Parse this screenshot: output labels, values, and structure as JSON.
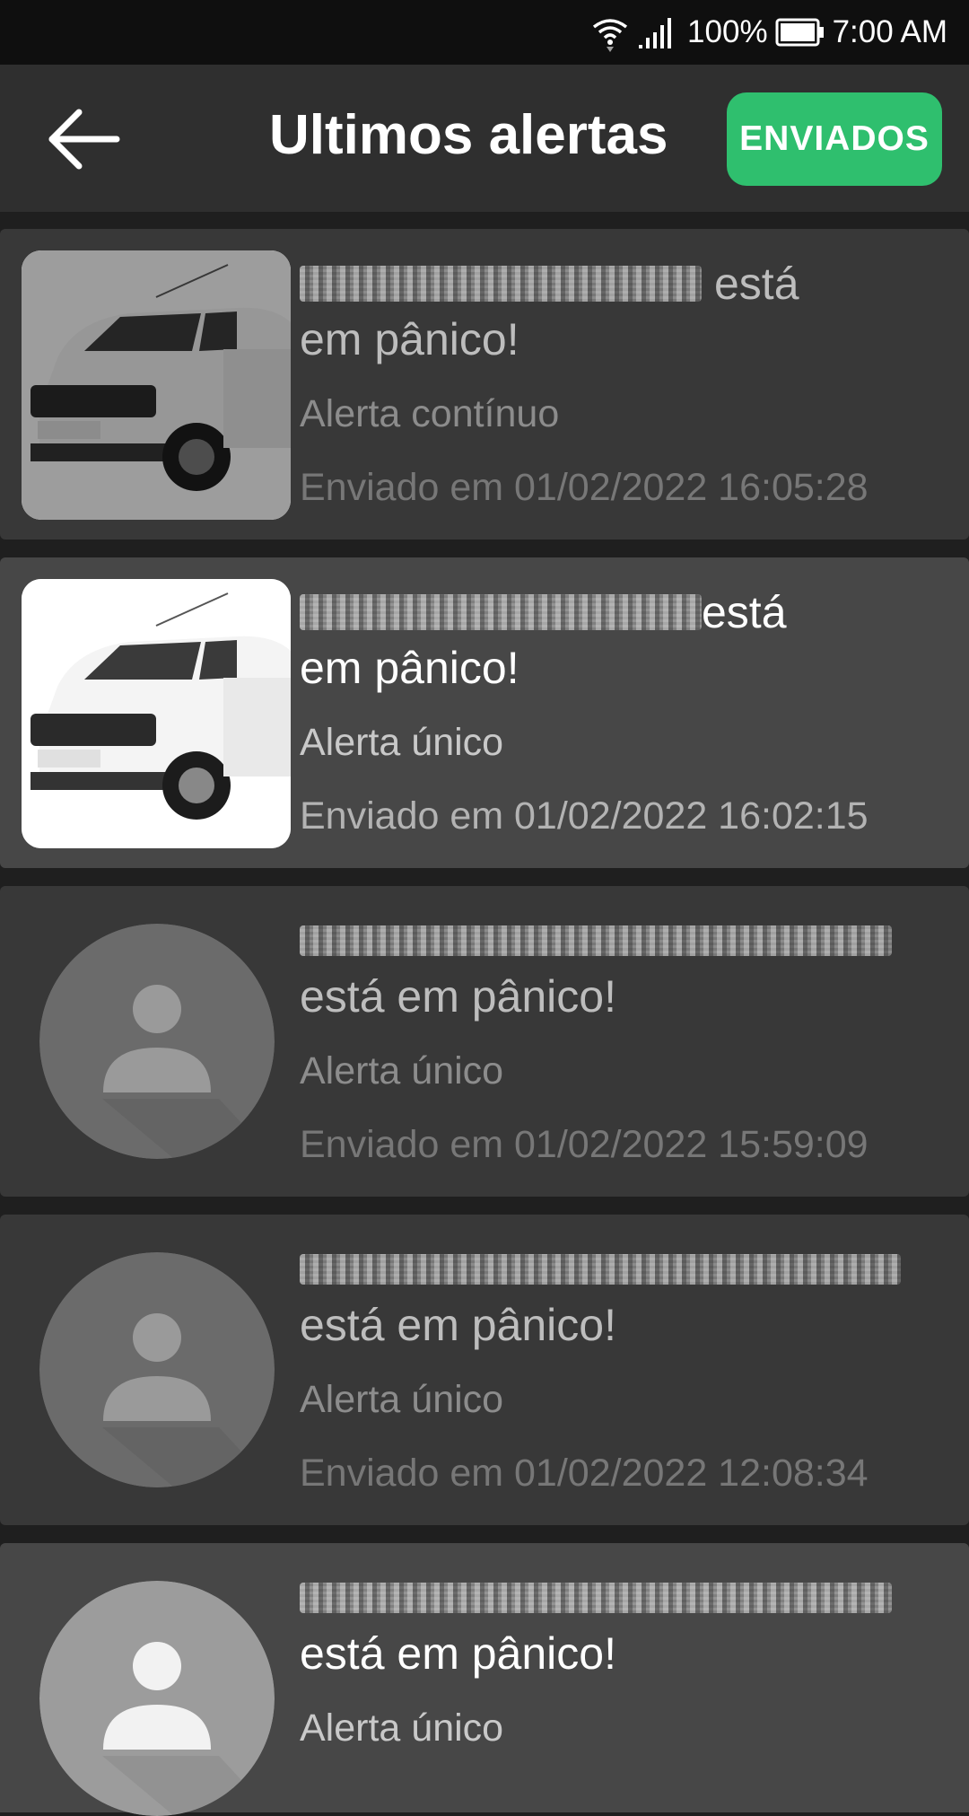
{
  "status_bar": {
    "battery": "100%",
    "time": "7:00 AM"
  },
  "header": {
    "title": "Ultimos alertas",
    "sent_button": "ENVIADOS"
  },
  "alerts": [
    {
      "status_part1": "está",
      "status_part2": "em pânico!",
      "type": "Alerta contínuo",
      "sent": "Enviado em 01/02/2022 16:05:28",
      "image": "car"
    },
    {
      "status_part1": "está",
      "status_part2": "em pânico!",
      "type": "Alerta único",
      "sent": "Enviado em 01/02/2022 16:02:15",
      "image": "car"
    },
    {
      "status_line": "está em pânico!",
      "type": "Alerta único",
      "sent": "Enviado em 01/02/2022 15:59:09",
      "image": "avatar"
    },
    {
      "status_line": "está em pânico!",
      "type": "Alerta único",
      "sent": "Enviado em 01/02/2022 12:08:34",
      "image": "avatar"
    },
    {
      "status_line": "está em pânico!",
      "type": "Alerta único",
      "image": "avatar"
    }
  ],
  "icons": {
    "back": "arrow-left-icon",
    "wifi": "wifi-icon",
    "signal": "signal-icon",
    "battery": "battery-icon",
    "avatar": "person-icon"
  },
  "colors": {
    "accent_green": "#2fbf6e",
    "app_bar": "#2f2f2f",
    "card": "#383838",
    "card_highlight": "#474747"
  }
}
